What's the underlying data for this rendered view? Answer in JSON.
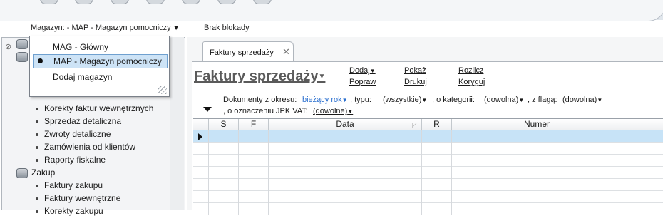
{
  "header": {
    "magazyn_label": "Magazyn: - MAP - Magazyn pomocniczy",
    "blokady_label": "Brak blokady"
  },
  "magazyn_popup": {
    "items": [
      {
        "label": "MAG - Główny",
        "selected": false
      },
      {
        "label": "MAP - Magazyn pomocniczy",
        "selected": true
      },
      {
        "label": "Dodaj magazyn",
        "selected": false
      }
    ]
  },
  "sidebar": {
    "items": [
      {
        "label": "Korekty faktur wewnętrznych"
      },
      {
        "label": "Sprzedaż detaliczna"
      },
      {
        "label": "Zwroty detaliczne"
      },
      {
        "label": "Zamówienia od klientów"
      },
      {
        "label": "Raporty fiskalne"
      }
    ],
    "group": {
      "label": "Zakup"
    },
    "group_items": [
      {
        "label": "Faktury zakupu"
      },
      {
        "label": "Faktury wewnętrzne"
      },
      {
        "label": "Korekty zakupu"
      }
    ]
  },
  "tab": {
    "label": "Faktury sprzedaży",
    "close": "✕"
  },
  "page": {
    "title": "Faktury sprzedaży",
    "actions": {
      "dodaj": "Dodaj",
      "popraw": "Popraw",
      "pokaz": "Pokaż",
      "drukuj": "Drukuj",
      "rozlicz": "Rozlicz",
      "koryguj": "Koryguj"
    }
  },
  "filters": {
    "okres_label": "Dokumenty z okresu:",
    "okres_value": "bieżący rok",
    "typ_label": ", typu:",
    "typ_value": "(wszystkie)",
    "kategoria_label": ", o kategorii:",
    "kategoria_value": "(dowolna)",
    "flaga_label": ", z flagą:",
    "flaga_value": "(dowolna)",
    "jpk_label": ", o oznaczeniu JPK VAT:",
    "jpk_value": "(dowolne)"
  },
  "grid": {
    "columns": [
      "",
      "S",
      "F",
      "Data",
      "R",
      "Numer",
      ""
    ],
    "row_count": 7
  },
  "colors": {
    "selection": "#c7e3f7",
    "link_blue": "#2a6fcf",
    "title_gray": "#5a5a5a"
  }
}
